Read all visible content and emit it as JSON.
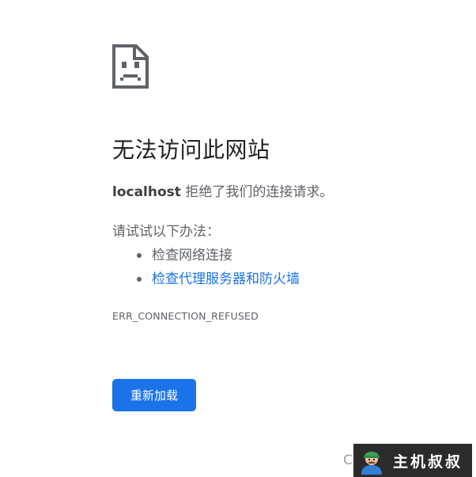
{
  "error_page": {
    "title": "无法访问此网站",
    "host": "localhost",
    "summary_suffix": " 拒绝了我们的连接请求。",
    "suggestions_heading": "请试试以下办法：",
    "suggestions": [
      {
        "label": "检查网络连接",
        "is_link": false
      },
      {
        "label": "检查代理服务器和防火墙",
        "is_link": true
      }
    ],
    "error_code": "ERR_CONNECTION_REFUSED",
    "reload_label": "重新加载",
    "partial_text": "C"
  },
  "watermark": {
    "text": "主机叔叔"
  },
  "colors": {
    "text_primary": "#202124",
    "text_secondary": "#5f6368",
    "link": "#1a73e8",
    "button_bg": "#1a73e8",
    "button_text": "#ffffff",
    "watermark_bg": "#2b2b2b"
  },
  "icons": {
    "error": "sad-page-icon",
    "watermark": "avatar-icon"
  }
}
